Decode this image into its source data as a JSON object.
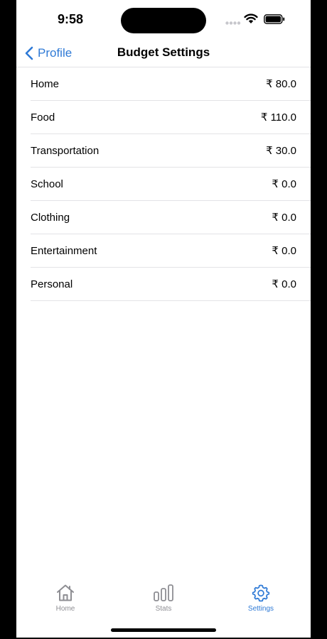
{
  "status_bar": {
    "time": "9:58"
  },
  "nav": {
    "back_label": "Profile",
    "title": "Budget Settings"
  },
  "budget_items": [
    {
      "label": "Home",
      "amount": "₹ 80.0"
    },
    {
      "label": "Food",
      "amount": "₹ 110.0"
    },
    {
      "label": "Transportation",
      "amount": "₹ 30.0"
    },
    {
      "label": "School",
      "amount": "₹ 0.0"
    },
    {
      "label": "Clothing",
      "amount": "₹ 0.0"
    },
    {
      "label": "Entertainment",
      "amount": "₹ 0.0"
    },
    {
      "label": "Personal",
      "amount": "₹ 0.0"
    }
  ],
  "tab_bar": {
    "home": {
      "label": "Home",
      "icon": "house-icon"
    },
    "stats": {
      "label": "Stats",
      "icon": "bar-chart-icon"
    },
    "settings": {
      "label": "Settings",
      "icon": "gear-icon",
      "active": true
    }
  },
  "colors": {
    "accent": "#2f7ad6",
    "inactive": "#8e8e93",
    "divider": "#e3e3e6"
  }
}
